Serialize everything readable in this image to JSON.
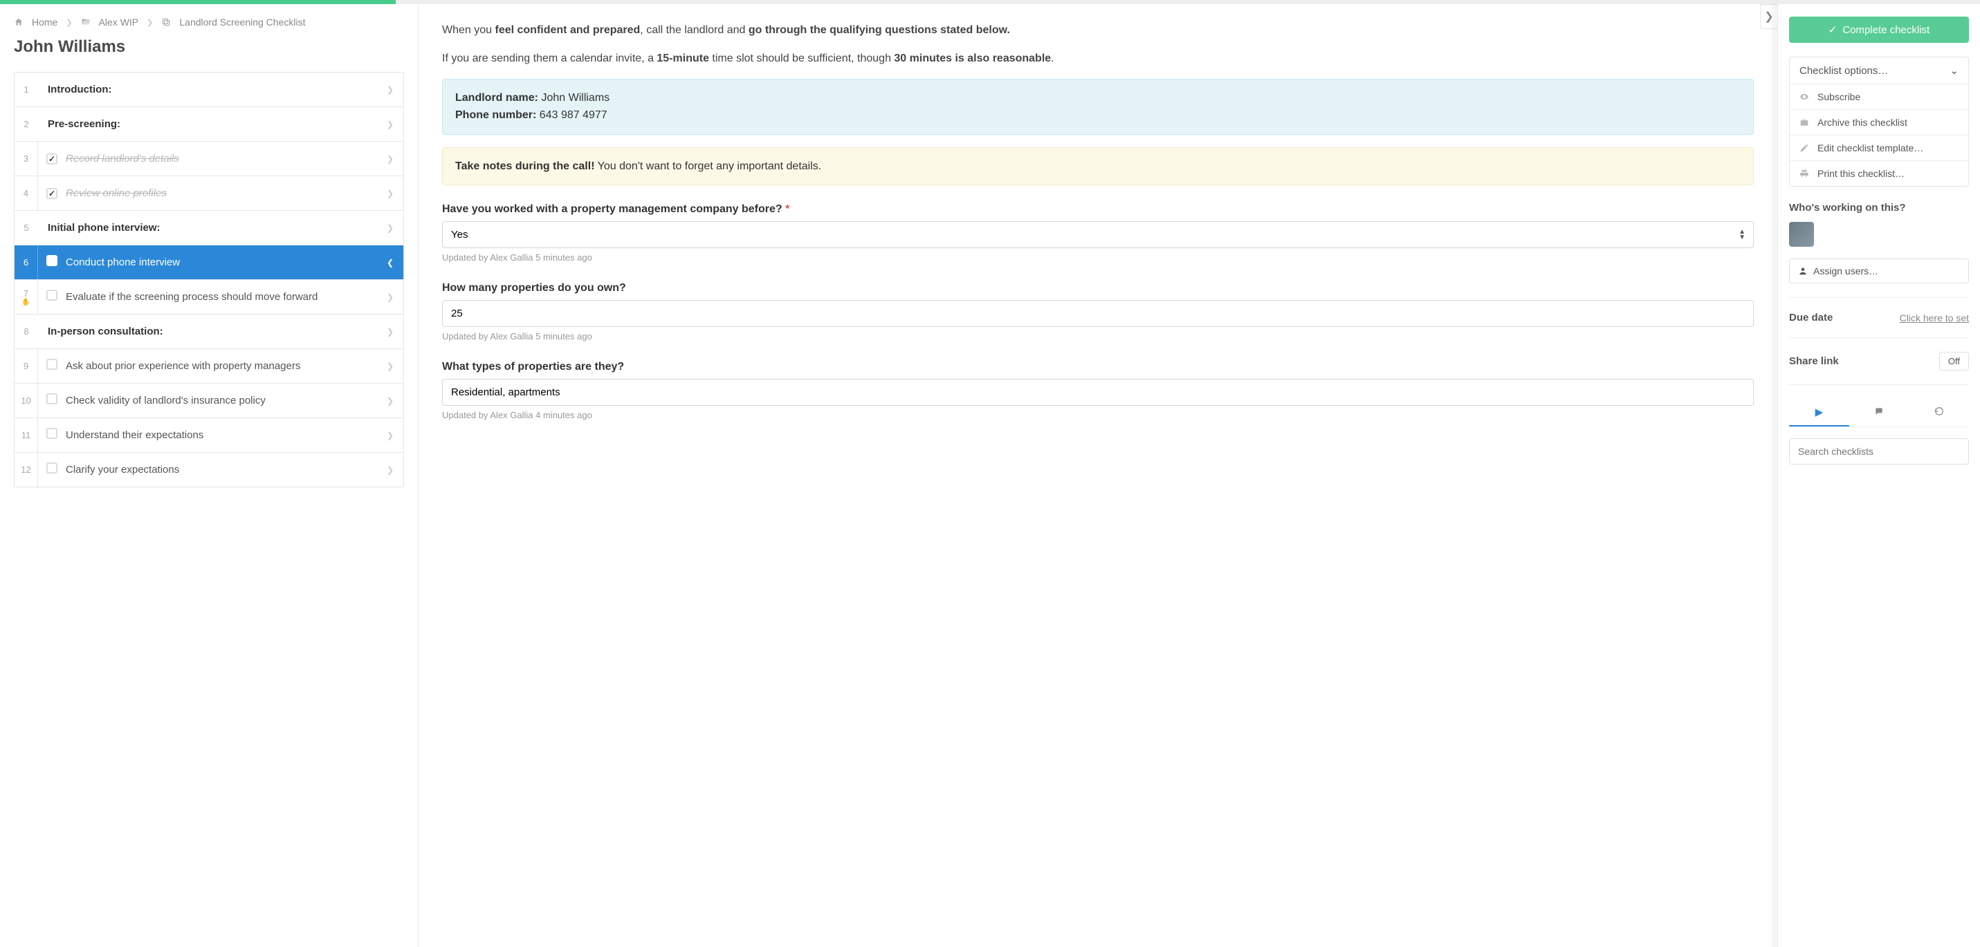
{
  "progress_percent": 20,
  "breadcrumb": {
    "home": "Home",
    "folder": "Alex WIP",
    "template": "Landlord Screening Checklist"
  },
  "page_title": "John Williams",
  "tasks": [
    {
      "num": "1",
      "label": "Introduction:",
      "type": "section"
    },
    {
      "num": "2",
      "label": "Pre-screening:",
      "type": "section"
    },
    {
      "num": "3",
      "label": "Record landlord's details",
      "type": "item",
      "checked": true,
      "completed": true
    },
    {
      "num": "4",
      "label": "Review online profiles",
      "type": "item",
      "checked": true,
      "completed": true
    },
    {
      "num": "5",
      "label": "Initial phone interview:",
      "type": "section"
    },
    {
      "num": "6",
      "label": "Conduct phone interview",
      "type": "item",
      "checked": false,
      "active": true
    },
    {
      "num": "7",
      "label": "Evaluate if the screening process should move forward",
      "type": "item",
      "checked": false,
      "stop": true
    },
    {
      "num": "8",
      "label": "In-person consultation:",
      "type": "section"
    },
    {
      "num": "9",
      "label": "Ask about prior experience with property managers",
      "type": "item",
      "checked": false
    },
    {
      "num": "10",
      "label": "Check validity of landlord's insurance policy",
      "type": "item",
      "checked": false
    },
    {
      "num": "11",
      "label": "Understand their expectations",
      "type": "item",
      "checked": false
    },
    {
      "num": "12",
      "label": "Clarify your expectations",
      "type": "item",
      "checked": false
    }
  ],
  "detail": {
    "intro_pre": "When you ",
    "intro_bold1": "feel confident and prepared",
    "intro_mid": ", call the landlord and ",
    "intro_bold2": "go through the qualifying questions stated below.",
    "para2_pre": "If you are sending them a calendar invite, a ",
    "para2_b1": "15-minute",
    "para2_mid": " time slot should be sufficient, though ",
    "para2_b2": "30 minutes is also reasonable",
    "para2_post": ".",
    "landlord_label": "Landlord name:",
    "landlord_value": "John Williams",
    "phone_label": "Phone number:",
    "phone_value": "643 987 4977",
    "note_bold": "Take notes during the call!",
    "note_rest": " You don't want to forget any important details.",
    "q1_label": "Have you worked with a property management company before?",
    "q1_value": "Yes",
    "q1_updated": "Updated by Alex Gallia 5 minutes ago",
    "q2_label": "How many properties do you own?",
    "q2_value": "25",
    "q2_updated": "Updated by Alex Gallia 5 minutes ago",
    "q3_label": "What types of properties are they?",
    "q3_value": "Residential, apartments",
    "q3_updated": "Updated by Alex Gallia 4 minutes ago"
  },
  "sidebar": {
    "complete_btn": "Complete checklist",
    "options_label": "Checklist options…",
    "items": [
      {
        "icon": "eye",
        "label": "Subscribe"
      },
      {
        "icon": "briefcase",
        "label": "Archive this checklist"
      },
      {
        "icon": "pencil",
        "label": "Edit checklist template…"
      },
      {
        "icon": "print",
        "label": "Print this checklist…"
      }
    ],
    "who_title": "Who's working on this?",
    "assign_label": "Assign users…",
    "due_title": "Due date",
    "due_link": "Click here to set",
    "share_title": "Share link",
    "share_value": "Off",
    "search_placeholder": "Search checklists"
  }
}
